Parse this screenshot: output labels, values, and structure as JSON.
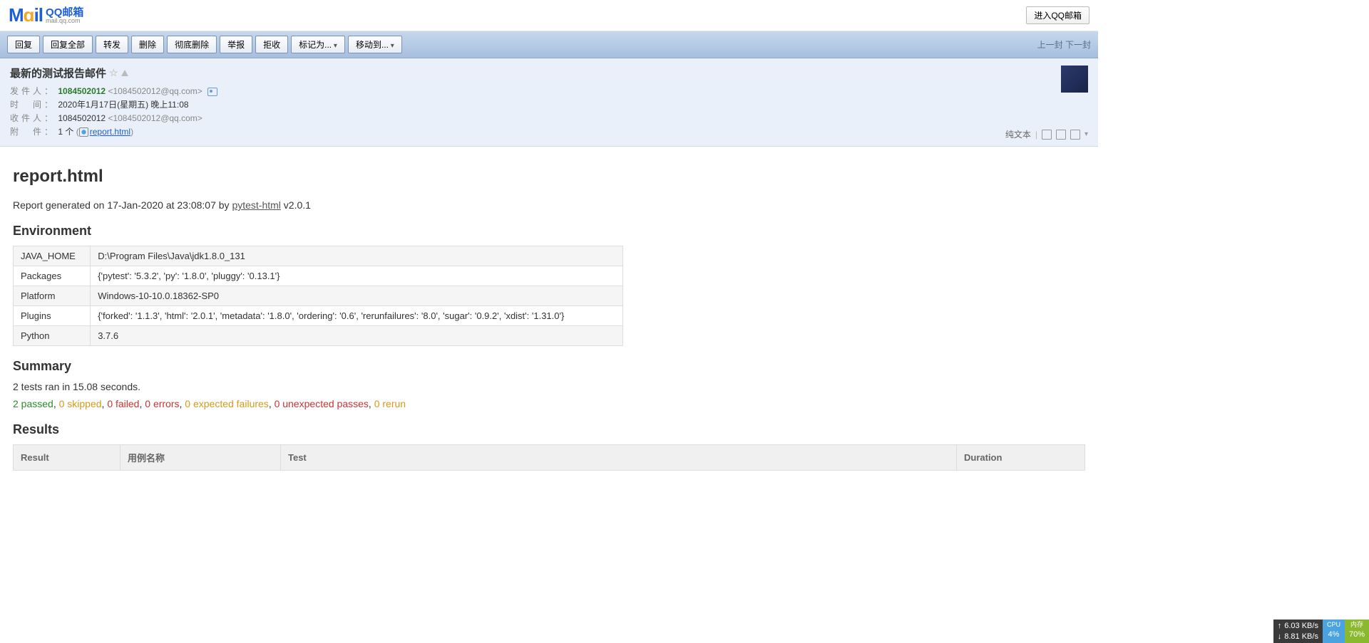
{
  "header": {
    "logo_cn": "QQ邮箱",
    "logo_en": "mail.qq.com",
    "enter_btn": "进入QQ邮箱"
  },
  "toolbar": {
    "reply": "回复",
    "reply_all": "回复全部",
    "forward": "转发",
    "delete": "删除",
    "delete_perm": "彻底删除",
    "report": "举报",
    "reject": "拒收",
    "mark_as": "标记为...",
    "move_to": "移动到...",
    "prev": "上一封",
    "next": "下一封"
  },
  "meta": {
    "subject": "最新的测试报告邮件",
    "from_label": "发件人：",
    "sender_name": "1084502012",
    "sender_addr": "<1084502012@qq.com>",
    "time_label": "时　间：",
    "time_value": "2020年1月17日(星期五) 晚上11:08",
    "to_label": "收件人：",
    "recipient_name": "1084502012",
    "recipient_addr": "<1084502012@qq.com>",
    "attach_label": "附　件：",
    "attach_count": "1 个",
    "attach_name": "report.html",
    "plaintext": "纯文本"
  },
  "report": {
    "title": "report.html",
    "generated_prefix": "Report generated on 17-Jan-2020 at 23:08:07 by ",
    "generator_link": "pytest-html",
    "generator_version": " v2.0.1",
    "env_heading": "Environment",
    "env": [
      {
        "k": "JAVA_HOME",
        "v": "D:\\Program Files\\Java\\jdk1.8.0_131"
      },
      {
        "k": "Packages",
        "v": "{'pytest': '5.3.2', 'py': '1.8.0', 'pluggy': '0.13.1'}"
      },
      {
        "k": "Platform",
        "v": "Windows-10-10.0.18362-SP0"
      },
      {
        "k": "Plugins",
        "v": "{'forked': '1.1.3', 'html': '2.0.1', 'metadata': '1.8.0', 'ordering': '0.6', 'rerunfailures': '8.0', 'sugar': '0.9.2', 'xdist': '1.31.0'}"
      },
      {
        "k": "Python",
        "v": "3.7.6"
      }
    ],
    "summary_heading": "Summary",
    "summary_line": "2 tests ran in 15.08 seconds.",
    "outcomes": {
      "passed": "2 passed",
      "skipped": "0 skipped",
      "failed": "0 failed",
      "errors": "0 errors",
      "expected": "0 expected failures",
      "unexpected": "0 unexpected passes",
      "rerun": "0 rerun"
    },
    "results_heading": "Results",
    "results_cols": {
      "result": "Result",
      "case": "用例名称",
      "test": "Test",
      "duration": "Duration"
    }
  },
  "perf": {
    "up": "6.03 KB/s",
    "down": "8.81 KB/s",
    "cpu_label": "CPU",
    "cpu_val": "4%",
    "mem_label": "内存",
    "mem_val": "70%"
  }
}
